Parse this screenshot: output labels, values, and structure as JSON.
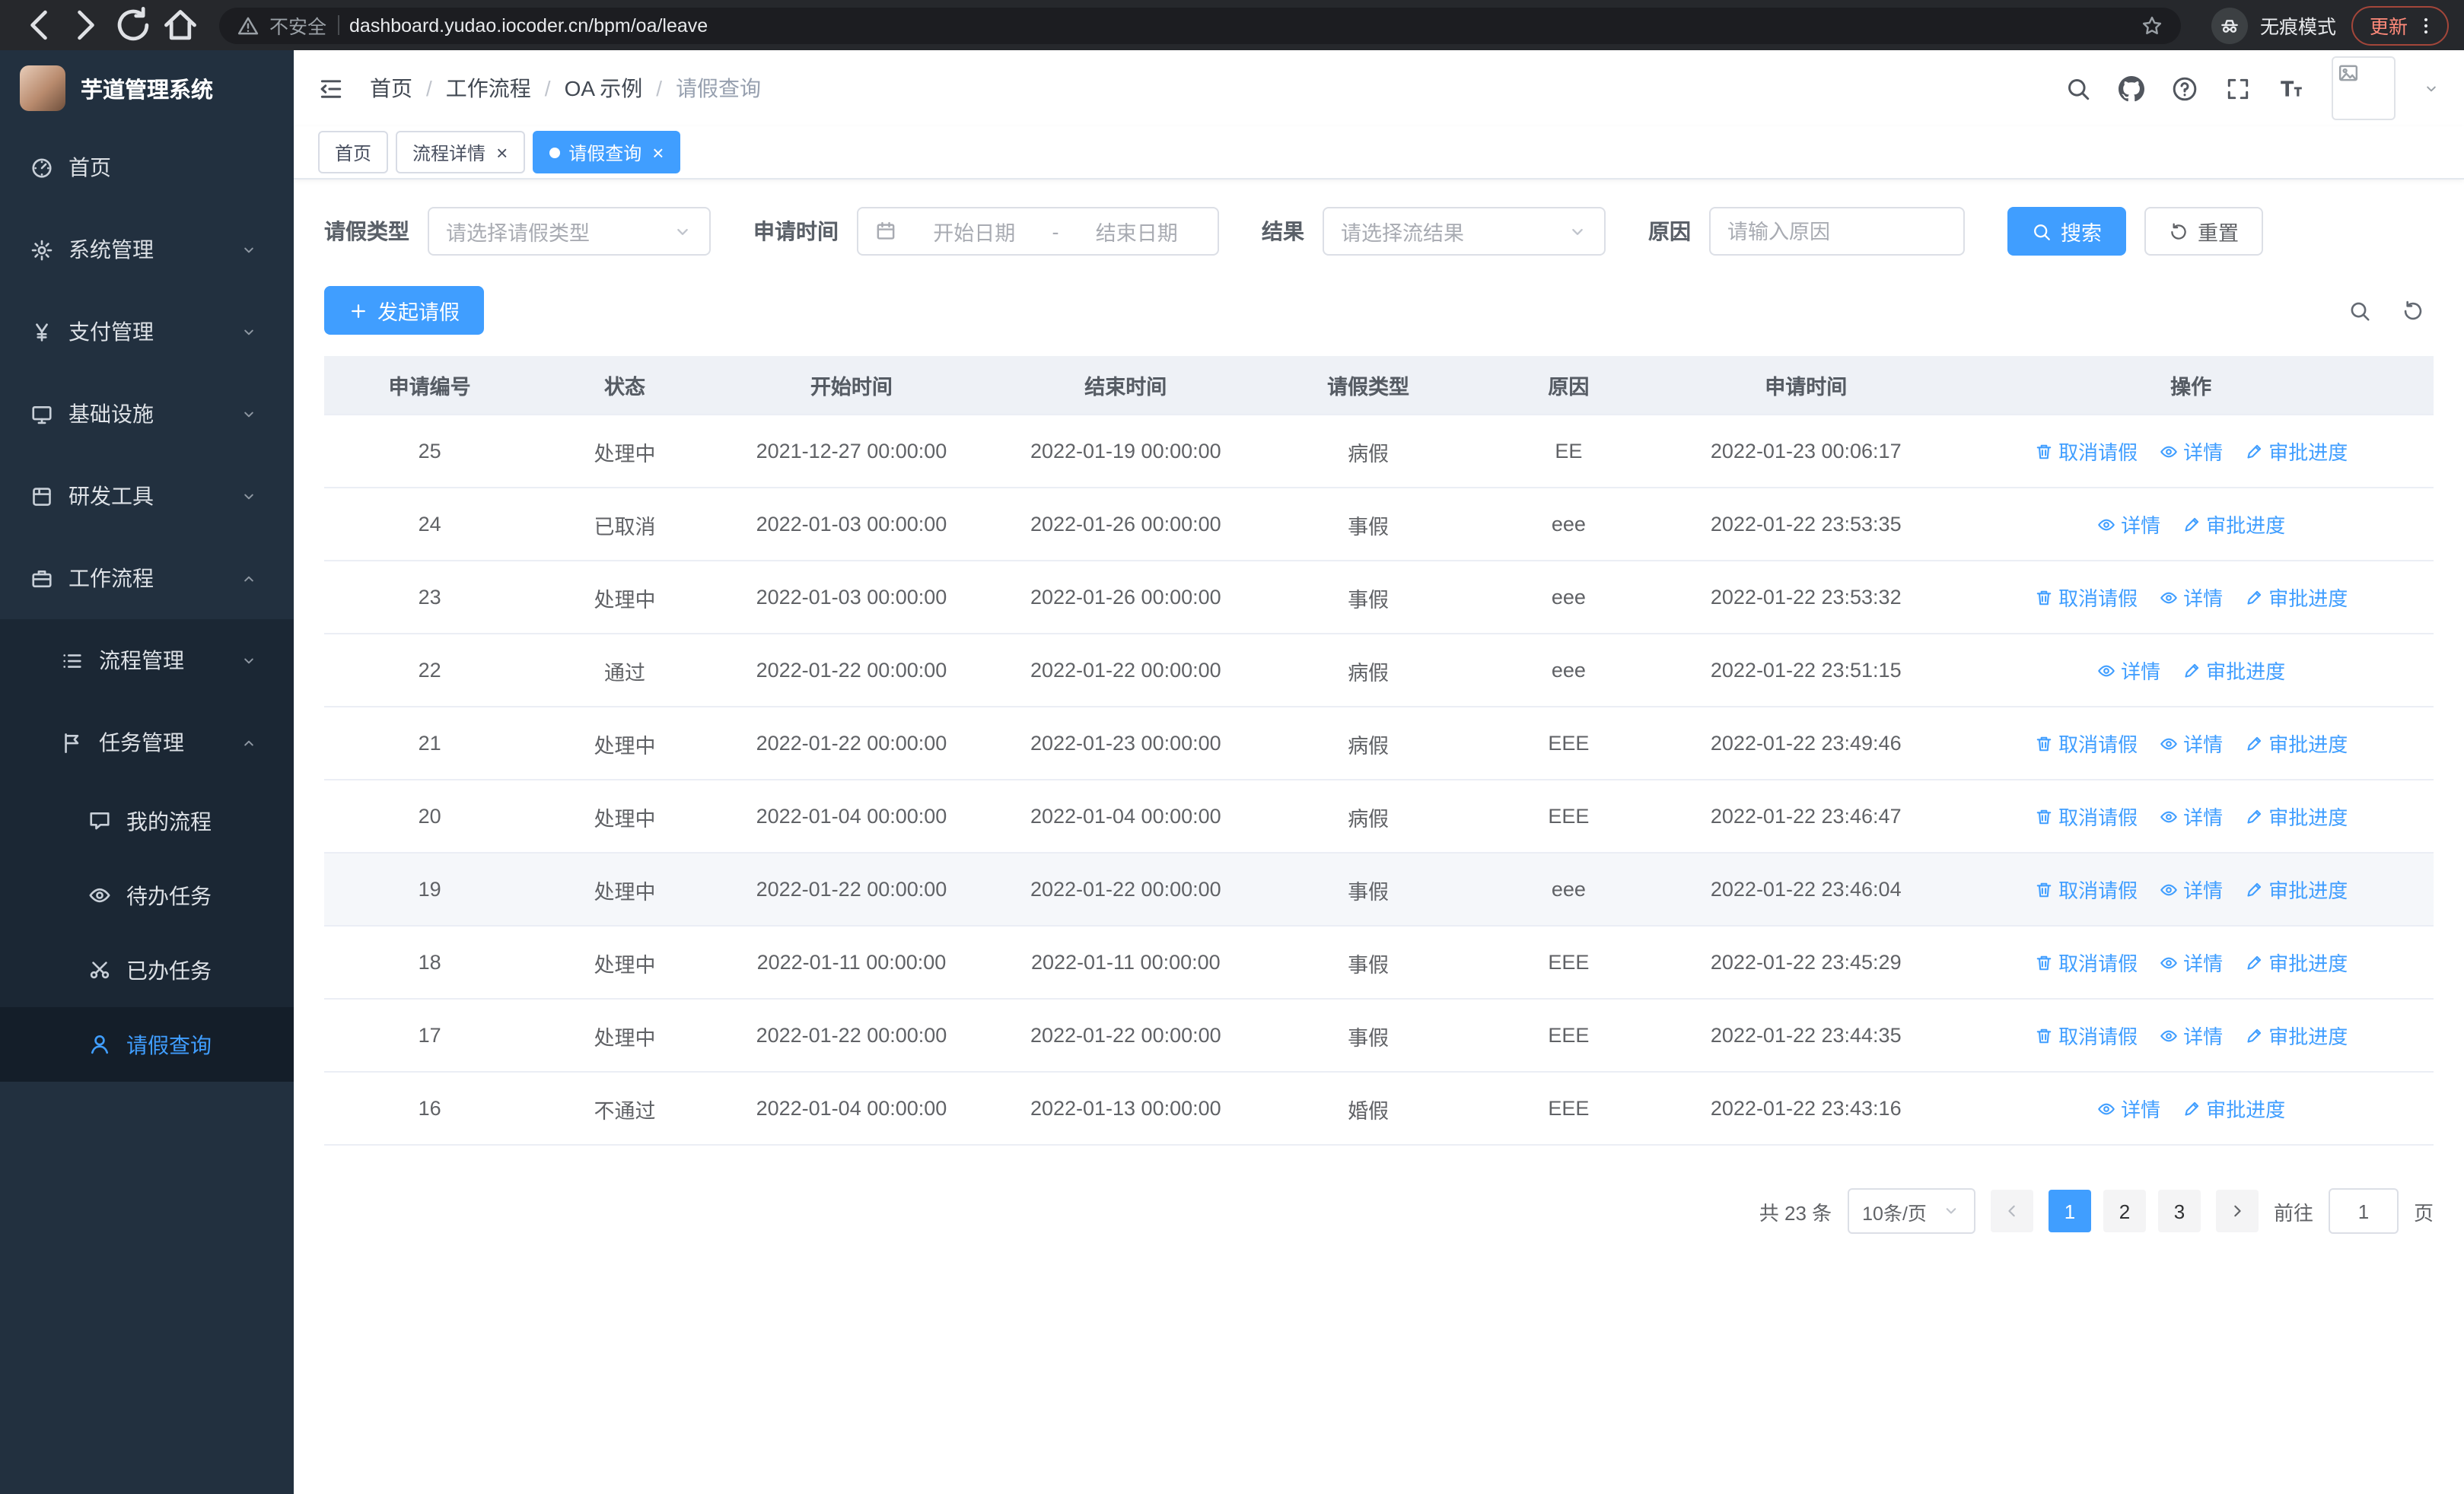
{
  "browser": {
    "security_label": "不安全",
    "url": "dashboard.yudao.iocoder.cn/bpm/oa/leave",
    "incognito_label": "无痕模式",
    "update_label": "更新"
  },
  "sidebar": {
    "logo_title": "芋道管理系统",
    "items": [
      {
        "label": "首页",
        "icon": "dashboard",
        "level": 1
      },
      {
        "label": "系统管理",
        "icon": "gear",
        "level": 1,
        "expandable": true
      },
      {
        "label": "支付管理",
        "icon": "yen",
        "level": 1,
        "expandable": true
      },
      {
        "label": "基础设施",
        "icon": "infra",
        "level": 1,
        "expandable": true
      },
      {
        "label": "研发工具",
        "icon": "tool",
        "level": 1,
        "expandable": true
      },
      {
        "label": "工作流程",
        "icon": "work",
        "level": 1,
        "expandable": true,
        "expanded": true
      },
      {
        "label": "流程管理",
        "icon": "list",
        "level": 2,
        "sub": true,
        "expandable": true
      },
      {
        "label": "任务管理",
        "icon": "flag",
        "level": 2,
        "sub": true,
        "expandable": true,
        "expanded": true
      },
      {
        "label": "我的流程",
        "icon": "chat",
        "level": 3,
        "sub": true
      },
      {
        "label": "待办任务",
        "icon": "eye",
        "level": 3,
        "sub": true
      },
      {
        "label": "已办任务",
        "icon": "done",
        "level": 3,
        "sub": true
      },
      {
        "label": "请假查询",
        "icon": "user",
        "level": 3,
        "sub": true,
        "active": true
      }
    ]
  },
  "header": {
    "breadcrumb": [
      "首页",
      "工作流程",
      "OA 示例",
      "请假查询"
    ]
  },
  "tabs": [
    {
      "label": "首页",
      "closable": false,
      "active": false
    },
    {
      "label": "流程详情",
      "closable": true,
      "active": false
    },
    {
      "label": "请假查询",
      "closable": true,
      "active": true
    }
  ],
  "filters": {
    "leave_type_label": "请假类型",
    "leave_type_placeholder": "请选择请假类型",
    "apply_time_label": "申请时间",
    "date_start_placeholder": "开始日期",
    "date_separator": "-",
    "date_end_placeholder": "结束日期",
    "result_label": "结果",
    "result_placeholder": "请选择流结果",
    "reason_label": "原因",
    "reason_placeholder": "请输入原因",
    "search_label": "搜索",
    "reset_label": "重置"
  },
  "toolbar": {
    "create_label": "发起请假"
  },
  "table": {
    "columns": [
      "申请编号",
      "状态",
      "开始时间",
      "结束时间",
      "请假类型",
      "原因",
      "申请时间",
      "操作"
    ],
    "rows": [
      {
        "id": "25",
        "status": "处理中",
        "start": "2021-12-27 00:00:00",
        "end": "2022-01-19 00:00:00",
        "type": "病假",
        "reason": "EE",
        "applied": "2022-01-23 00:06:17",
        "highlight": false,
        "actions": [
          {
            "label": "取消请假",
            "icon": "delete"
          },
          {
            "label": "详情",
            "icon": "view"
          },
          {
            "label": "审批进度",
            "icon": "edit"
          }
        ]
      },
      {
        "id": "24",
        "status": "已取消",
        "start": "2022-01-03 00:00:00",
        "end": "2022-01-26 00:00:00",
        "type": "事假",
        "reason": "eee",
        "applied": "2022-01-22 23:53:35",
        "highlight": false,
        "actions": [
          {
            "label": "详情",
            "icon": "view"
          },
          {
            "label": "审批进度",
            "icon": "edit"
          }
        ]
      },
      {
        "id": "23",
        "status": "处理中",
        "start": "2022-01-03 00:00:00",
        "end": "2022-01-26 00:00:00",
        "type": "事假",
        "reason": "eee",
        "applied": "2022-01-22 23:53:32",
        "highlight": false,
        "actions": [
          {
            "label": "取消请假",
            "icon": "delete"
          },
          {
            "label": "详情",
            "icon": "view"
          },
          {
            "label": "审批进度",
            "icon": "edit"
          }
        ]
      },
      {
        "id": "22",
        "status": "通过",
        "start": "2022-01-22 00:00:00",
        "end": "2022-01-22 00:00:00",
        "type": "病假",
        "reason": "eee",
        "applied": "2022-01-22 23:51:15",
        "highlight": false,
        "actions": [
          {
            "label": "详情",
            "icon": "view"
          },
          {
            "label": "审批进度",
            "icon": "edit"
          }
        ]
      },
      {
        "id": "21",
        "status": "处理中",
        "start": "2022-01-22 00:00:00",
        "end": "2022-01-23 00:00:00",
        "type": "病假",
        "reason": "EEE",
        "applied": "2022-01-22 23:49:46",
        "highlight": false,
        "actions": [
          {
            "label": "取消请假",
            "icon": "delete"
          },
          {
            "label": "详情",
            "icon": "view"
          },
          {
            "label": "审批进度",
            "icon": "edit"
          }
        ]
      },
      {
        "id": "20",
        "status": "处理中",
        "start": "2022-01-04 00:00:00",
        "end": "2022-01-04 00:00:00",
        "type": "病假",
        "reason": "EEE",
        "applied": "2022-01-22 23:46:47",
        "highlight": false,
        "actions": [
          {
            "label": "取消请假",
            "icon": "delete"
          },
          {
            "label": "详情",
            "icon": "view"
          },
          {
            "label": "审批进度",
            "icon": "edit"
          }
        ]
      },
      {
        "id": "19",
        "status": "处理中",
        "start": "2022-01-22 00:00:00",
        "end": "2022-01-22 00:00:00",
        "type": "事假",
        "reason": "eee",
        "applied": "2022-01-22 23:46:04",
        "highlight": true,
        "actions": [
          {
            "label": "取消请假",
            "icon": "delete"
          },
          {
            "label": "详情",
            "icon": "view"
          },
          {
            "label": "审批进度",
            "icon": "edit"
          }
        ]
      },
      {
        "id": "18",
        "status": "处理中",
        "start": "2022-01-11 00:00:00",
        "end": "2022-01-11 00:00:00",
        "type": "事假",
        "reason": "EEE",
        "applied": "2022-01-22 23:45:29",
        "highlight": false,
        "actions": [
          {
            "label": "取消请假",
            "icon": "delete"
          },
          {
            "label": "详情",
            "icon": "view"
          },
          {
            "label": "审批进度",
            "icon": "edit"
          }
        ]
      },
      {
        "id": "17",
        "status": "处理中",
        "start": "2022-01-22 00:00:00",
        "end": "2022-01-22 00:00:00",
        "type": "事假",
        "reason": "EEE",
        "applied": "2022-01-22 23:44:35",
        "highlight": false,
        "actions": [
          {
            "label": "取消请假",
            "icon": "delete"
          },
          {
            "label": "详情",
            "icon": "view"
          },
          {
            "label": "审批进度",
            "icon": "edit"
          }
        ]
      },
      {
        "id": "16",
        "status": "不通过",
        "start": "2022-01-04 00:00:00",
        "end": "2022-01-13 00:00:00",
        "type": "婚假",
        "reason": "EEE",
        "applied": "2022-01-22 23:43:16",
        "highlight": false,
        "actions": [
          {
            "label": "详情",
            "icon": "view"
          },
          {
            "label": "审批进度",
            "icon": "edit"
          }
        ]
      }
    ]
  },
  "pagination": {
    "total_label": "共 23 条",
    "page_size": "10条/页",
    "pages": [
      "1",
      "2",
      "3"
    ],
    "active_page": "1",
    "goto_label": "前往",
    "goto_value": "1",
    "goto_suffix": "页"
  }
}
